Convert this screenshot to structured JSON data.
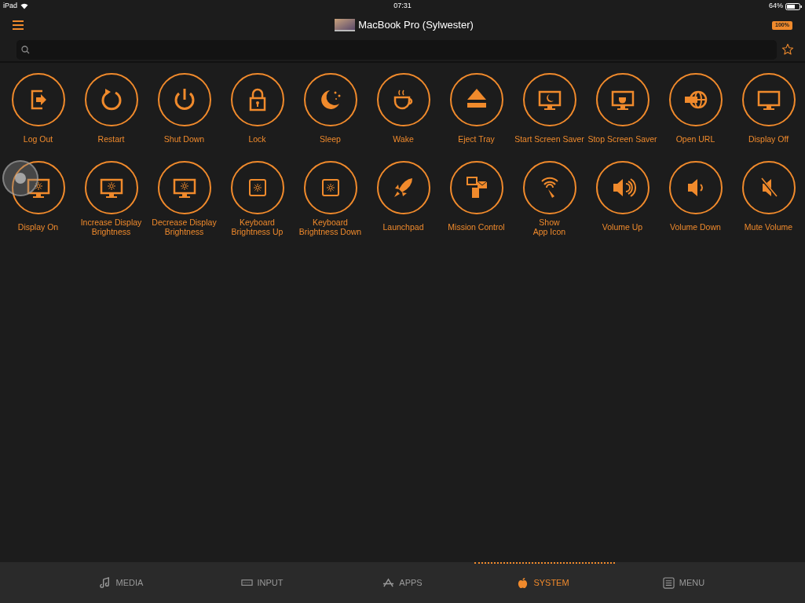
{
  "status_bar": {
    "device": "iPad",
    "time": "07:31",
    "battery": "64%"
  },
  "nav_bar": {
    "title": "MacBook Pro (Sylwester)",
    "battery_badge": "100%"
  },
  "actions": [
    {
      "kind": "logout",
      "label": "Log Out"
    },
    {
      "kind": "restart",
      "label": "Restart"
    },
    {
      "kind": "power",
      "label": "Shut Down"
    },
    {
      "kind": "lock",
      "label": "Lock"
    },
    {
      "kind": "sleep",
      "label": "Sleep"
    },
    {
      "kind": "wake",
      "label": "Wake"
    },
    {
      "kind": "eject",
      "label": "Eject Tray"
    },
    {
      "kind": "saver_start",
      "label": "Start Screen Saver"
    },
    {
      "kind": "saver_stop",
      "label": "Stop Screen Saver"
    },
    {
      "kind": "url",
      "label": "Open URL"
    },
    {
      "kind": "display_off",
      "label": "Display Off"
    },
    {
      "kind": "display_on",
      "label": "Display On"
    },
    {
      "kind": "bright_up",
      "label": "Increase Display\nBrightness"
    },
    {
      "kind": "bright_down",
      "label": "Decrease Display\nBrightness"
    },
    {
      "kind": "kb_up",
      "label": "Keyboard\nBrightness Up"
    },
    {
      "kind": "kb_down",
      "label": "Keyboard\nBrightness Down"
    },
    {
      "kind": "rocket",
      "label": "Launchpad"
    },
    {
      "kind": "mission",
      "label": "Mission Control"
    },
    {
      "kind": "show_icon",
      "label": "Show\nApp Icon"
    },
    {
      "kind": "vol_up",
      "label": "Volume Up"
    },
    {
      "kind": "vol_down",
      "label": "Volume Down"
    },
    {
      "kind": "mute",
      "label": "Mute Volume"
    }
  ],
  "tabs": [
    {
      "kind": "media",
      "label": "MEDIA",
      "selected": false
    },
    {
      "kind": "input",
      "label": "INPUT",
      "selected": false
    },
    {
      "kind": "apps",
      "label": "APPS",
      "selected": false
    },
    {
      "kind": "system",
      "label": "SYSTEM",
      "selected": true
    },
    {
      "kind": "menu",
      "label": "MENU",
      "selected": false
    }
  ]
}
